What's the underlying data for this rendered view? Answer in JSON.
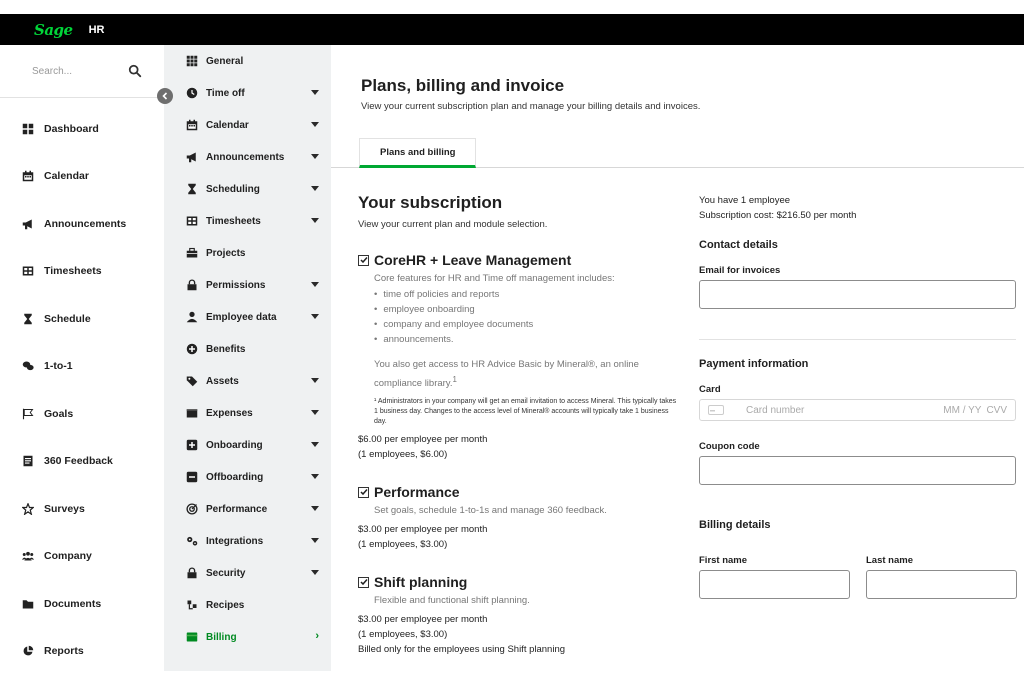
{
  "app": {
    "logo": "Sage",
    "name": "HR"
  },
  "search": {
    "placeholder": "Search..."
  },
  "sidebar": [
    {
      "label": "Dashboard",
      "icon": "dashboard-icon"
    },
    {
      "label": "Calendar",
      "icon": "calendar-icon"
    },
    {
      "label": "Announcements",
      "icon": "megaphone-icon"
    },
    {
      "label": "Timesheets",
      "icon": "timesheet-icon"
    },
    {
      "label": "Schedule",
      "icon": "hourglass-icon"
    },
    {
      "label": "1-to-1",
      "icon": "chat-icon"
    },
    {
      "label": "Goals",
      "icon": "flag-icon"
    },
    {
      "label": "360 Feedback",
      "icon": "feedback-icon"
    },
    {
      "label": "Surveys",
      "icon": "star-icon"
    },
    {
      "label": "Company",
      "icon": "users-icon"
    },
    {
      "label": "Documents",
      "icon": "folder-icon"
    },
    {
      "label": "Reports",
      "icon": "pie-chart-icon"
    }
  ],
  "settings_menu": [
    {
      "label": "General",
      "expandable": false
    },
    {
      "label": "Time off",
      "expandable": true
    },
    {
      "label": "Calendar",
      "expandable": true
    },
    {
      "label": "Announcements",
      "expandable": true
    },
    {
      "label": "Scheduling",
      "expandable": true
    },
    {
      "label": "Timesheets",
      "expandable": true
    },
    {
      "label": "Projects",
      "expandable": false
    },
    {
      "label": "Permissions",
      "expandable": true
    },
    {
      "label": "Employee data",
      "expandable": true
    },
    {
      "label": "Benefits",
      "expandable": false
    },
    {
      "label": "Assets",
      "expandable": true
    },
    {
      "label": "Expenses",
      "expandable": true
    },
    {
      "label": "Onboarding",
      "expandable": true
    },
    {
      "label": "Offboarding",
      "expandable": true
    },
    {
      "label": "Performance",
      "expandable": true
    },
    {
      "label": "Integrations",
      "expandable": true
    },
    {
      "label": "Security",
      "expandable": true
    },
    {
      "label": "Recipes",
      "expandable": false
    },
    {
      "label": "Billing",
      "expandable": false,
      "active": true
    }
  ],
  "page": {
    "title": "Plans, billing and invoice",
    "subtitle": "View your current subscription plan and manage your billing details and invoices.",
    "tab": "Plans and billing"
  },
  "subscription": {
    "title": "Your subscription",
    "subtitle": "View your current plan and module selection.",
    "modules": [
      {
        "name": "CoreHR + Leave Management",
        "checked": true,
        "description": "Core features for HR and Time off management includes:",
        "features": [
          "time off policies and reports",
          "employee onboarding",
          "company and employee documents",
          "announcements."
        ],
        "extra": "You also get access to HR Advice Basic by Mineral®, an online compliance library.",
        "note": "¹ Administrators in your company will get an email invitation to access Mineral. This typically takes 1 business day. Changes to the access level of Mineral® accounts will typically take 1 business day.",
        "price": "$6.00 per employee per month",
        "total": "(1 employees, $6.00)"
      },
      {
        "name": "Performance",
        "checked": true,
        "description": "Set goals, schedule 1-to-1s and manage 360 feedback.",
        "price": "$3.00 per employee per month",
        "total": "(1 employees, $3.00)"
      },
      {
        "name": "Shift planning",
        "checked": true,
        "description": "Flexible and functional shift planning.",
        "price": "$3.00 per employee per month",
        "total": "(1 employees, $3.00)",
        "footnote": "Billed only for the employees using Shift planning"
      }
    ]
  },
  "billing": {
    "employees": "You have 1 employee",
    "cost": "Subscription cost: $216.50 per month",
    "contact_title": "Contact details",
    "email_label": "Email for invoices",
    "payment_title": "Payment information",
    "card_label": "Card",
    "card_placeholder": "Card number",
    "card_expiry": "MM / YY",
    "card_cvv": "CVV",
    "coupon_label": "Coupon code",
    "details_title": "Billing details",
    "first_name": "First name",
    "last_name": "Last name"
  },
  "colors": {
    "accent": "#00a832",
    "active_text": "#008a21",
    "logo": "#00d639",
    "topbar": "#000000",
    "settings_bg": "#eff1f2"
  }
}
